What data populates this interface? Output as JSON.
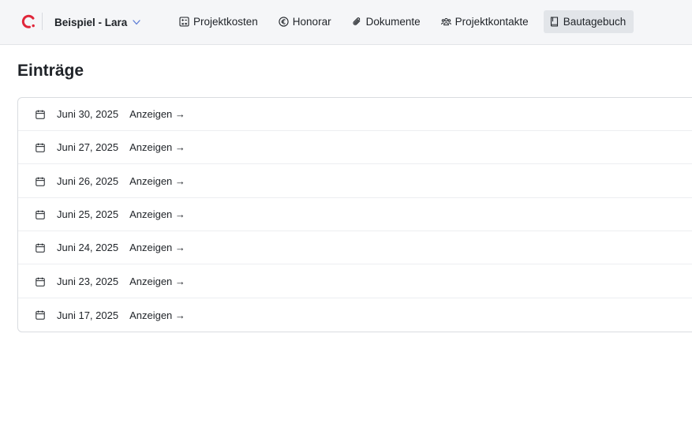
{
  "header": {
    "project_name": "Beispiel - Lara",
    "nav": [
      {
        "label": "Projektkosten",
        "icon": "calculator-icon"
      },
      {
        "label": "Honorar",
        "icon": "euro-icon"
      },
      {
        "label": "Dokumente",
        "icon": "paperclip-icon"
      },
      {
        "label": "Projektkontakte",
        "icon": "contacts-icon"
      },
      {
        "label": "Bautagebuch",
        "icon": "book-icon",
        "active": true
      }
    ]
  },
  "main": {
    "title": "Einträge",
    "entries": [
      {
        "date": "Juni 30, 2025",
        "action": "Anzeigen →"
      },
      {
        "date": "Juni 27, 2025",
        "action": "Anzeigen →"
      },
      {
        "date": "Juni 26, 2025",
        "action": "Anzeigen →"
      },
      {
        "date": "Juni 25, 2025",
        "action": "Anzeigen →"
      },
      {
        "date": "Juni 24, 2025",
        "action": "Anzeigen →"
      },
      {
        "date": "Juni 23, 2025",
        "action": "Anzeigen →"
      },
      {
        "date": "Juni 17, 2025",
        "action": "Anzeigen →"
      }
    ]
  },
  "colors": {
    "brand": "#e0263a",
    "active_tab_bg": "#e2e5e9",
    "chevron": "#5b7bd5"
  }
}
